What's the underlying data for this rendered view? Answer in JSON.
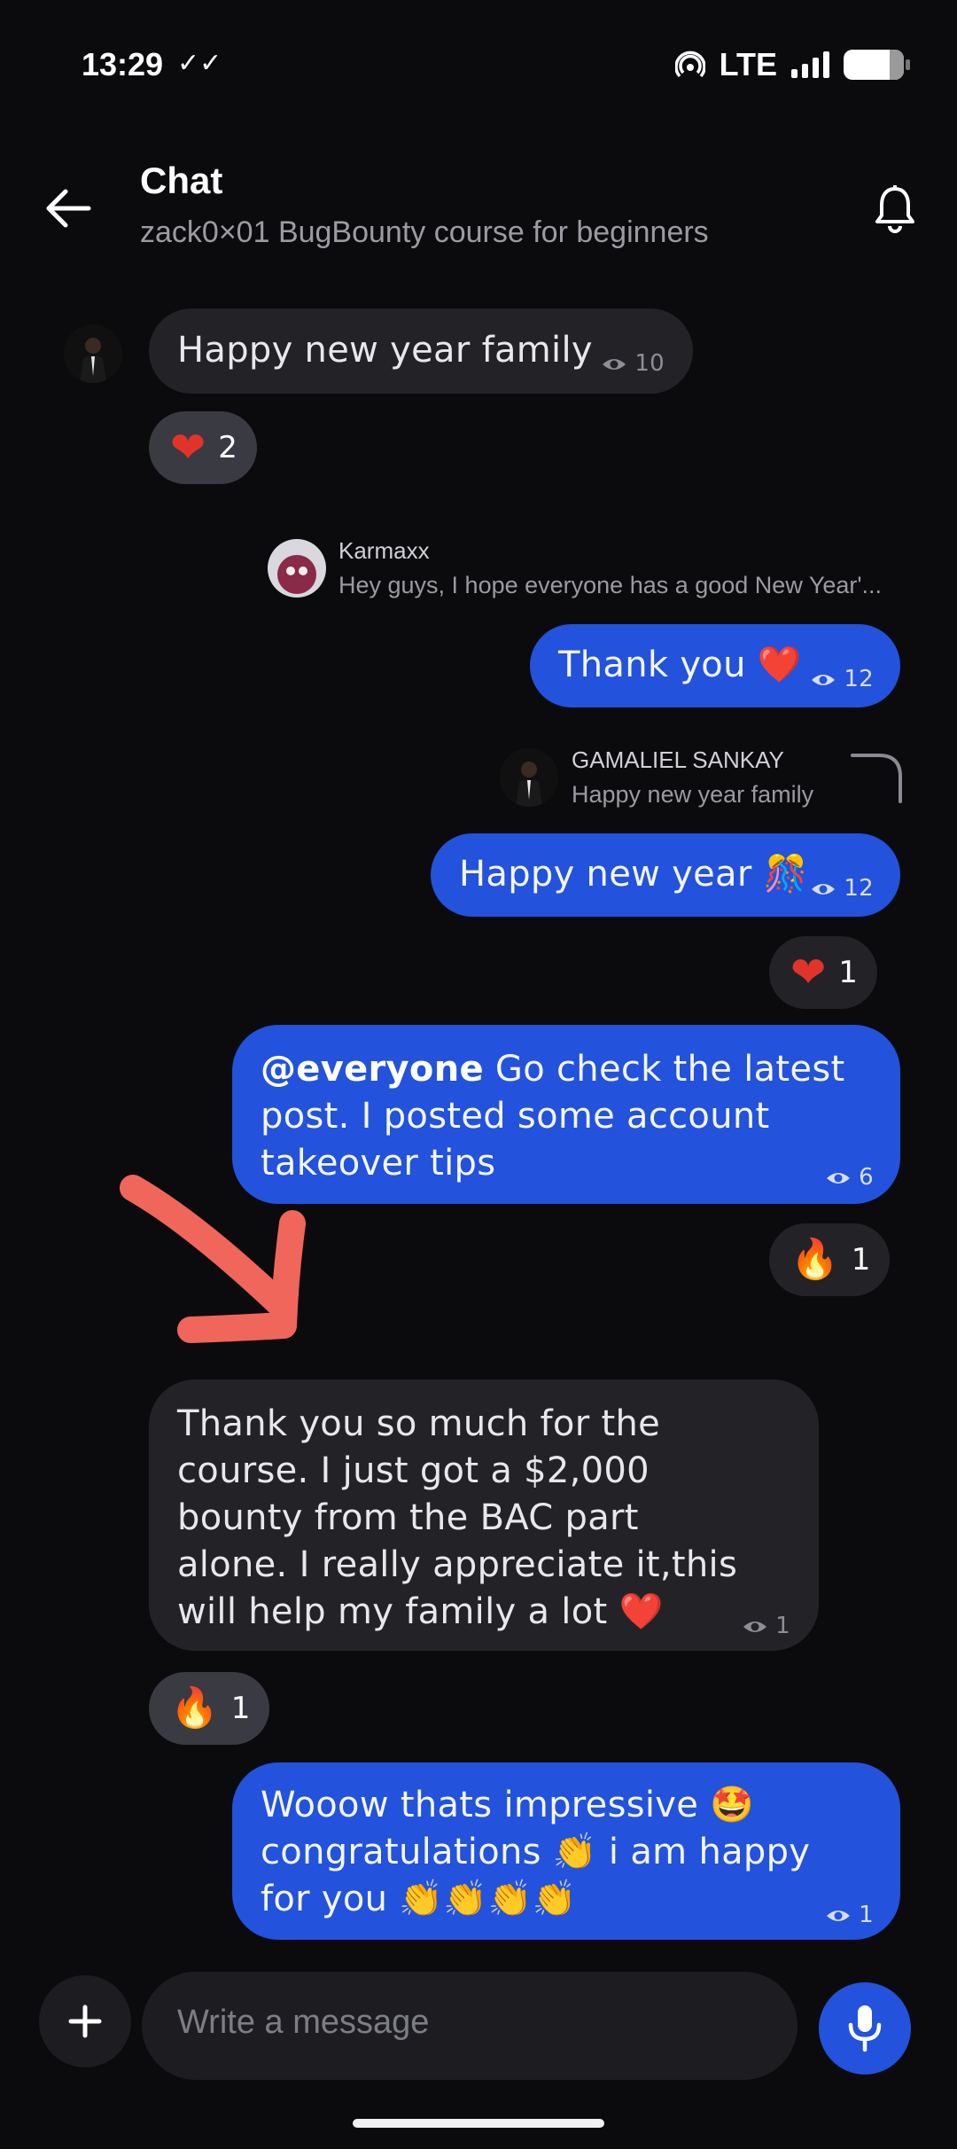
{
  "status_bar": {
    "time": "13:29",
    "network": "LTE"
  },
  "header": {
    "title": "Chat",
    "subtitle": "zack0×01 BugBounty course for beginners"
  },
  "messages": {
    "m1": {
      "text": "Happy new year family",
      "views": "10",
      "reaction_count": "2"
    },
    "m2": {
      "reply_name": "Karmaxx",
      "reply_text": "Hey guys, I hope everyone has a good New Year'...",
      "text": "Thank you ❤️",
      "views": "12"
    },
    "m3": {
      "reply_name": "GAMALIEL SANKAY",
      "reply_text": "Happy new year family",
      "text": "Happy new year 🎊",
      "views": "12",
      "reaction_count": "1"
    },
    "m4": {
      "mention": "@everyone",
      "text": " Go check the latest post. I posted some account takeover tips",
      "views": "6",
      "reaction_count": "1"
    },
    "m5": {
      "line1": "Thank you so much for the",
      "line2": "course. I just got a $2,000",
      "line3": "bounty from the BAC part",
      "line4": "alone. I really appreciate it,this",
      "line5": "will help my family a lot ❤️",
      "views": "1",
      "reaction_count": "1"
    },
    "m6": {
      "line1": "Wooow thats impressive 🤩",
      "line2": "congratulations 👏 i am happy",
      "line3": "for you 👏👏👏👏",
      "views": "1"
    }
  },
  "composer": {
    "placeholder": "Write a message"
  },
  "colors": {
    "accent": "#2352dc",
    "incoming_bubble": "#232327",
    "background": "#0b0b0d",
    "annotation_arrow": "#f0665a"
  },
  "icons": [
    "back-arrow-icon",
    "bell-icon",
    "eye-icon",
    "plus-icon",
    "mic-icon",
    "hotspot-icon",
    "signal-icon",
    "battery-icon"
  ]
}
